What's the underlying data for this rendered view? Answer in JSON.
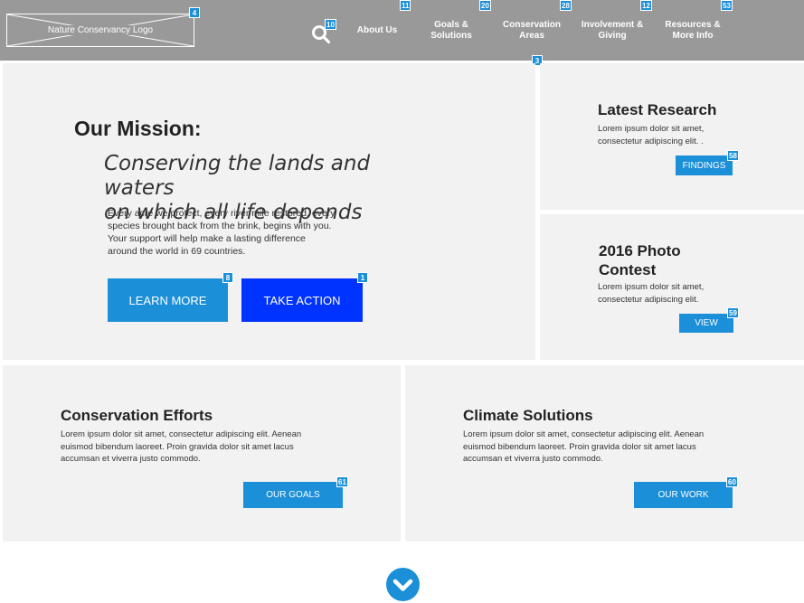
{
  "header": {
    "logo_text": "Nature Conservancy Logo",
    "nav": [
      {
        "label_line1": "About Us",
        "label_line2": "",
        "badge": "11"
      },
      {
        "label_line1": "Goals &",
        "label_line2": "Solutions",
        "badge": "20"
      },
      {
        "label_line1": "Conservation",
        "label_line2": "Areas",
        "badge": "28"
      },
      {
        "label_line1": "Involvement &",
        "label_line2": "Giving",
        "badge": "12"
      },
      {
        "label_line1": "Resources &",
        "label_line2": "More Info",
        "badge": "53"
      }
    ],
    "logo_badge": "4",
    "search_badge": "10",
    "dropdown_badge": "3"
  },
  "mission": {
    "title": "Our Mission:",
    "tagline_line1": "Conserving the lands and waters",
    "tagline_line2": "on which all life depends",
    "body": [
      "Every acre we protect, every river mile restored, every",
      "species brought back from the brink, begins with you.",
      "Your support will help make a lasting difference",
      "around the world in 69 countries."
    ],
    "learn_more_label": "LEARN MORE",
    "learn_more_badge": "8",
    "take_action_label": "TAKE ACTION",
    "take_action_badge": "1"
  },
  "research": {
    "title": "Latest Research",
    "text_line1": "Lorem ipsum dolor sit amet,",
    "text_line2": "consectetur adipiscing elit. .",
    "button_label": "FINDINGS",
    "button_badge": "58"
  },
  "photo_contest": {
    "title_line1": "2016 Photo",
    "title_line2": "Contest",
    "text_line1": "Lorem ipsum dolor sit amet,",
    "text_line2": "consectetur adipiscing elit.",
    "button_label": "VIEW",
    "button_badge": "59"
  },
  "conservation_efforts": {
    "title": "Conservation Efforts",
    "text": [
      "Lorem ipsum dolor sit amet, consectetur adipiscing elit. Aenean",
      "euismod bibendum laoreet. Proin gravida dolor sit amet lacus",
      "accumsan et viverra justo commodo."
    ],
    "button_label": "OUR GOALS",
    "button_badge": "61"
  },
  "climate_solutions": {
    "title": "Climate Solutions",
    "text": [
      "Lorem ipsum dolor sit amet, consectetur adipiscing elit. Aenean",
      "euismod bibendum laoreet. Proin gravida dolor sit amet lacus",
      "accumsan et viverra justo commodo."
    ],
    "button_label": "OUR WORK",
    "button_badge": "60"
  },
  "colors": {
    "header_bg": "#999999",
    "panel_bg": "#f2f2f2",
    "accent_blue": "#1b8fd8",
    "action_blue": "#0033ff"
  },
  "icons": {
    "search": "search-icon",
    "scroll_down": "chevron-down-circle-icon"
  }
}
